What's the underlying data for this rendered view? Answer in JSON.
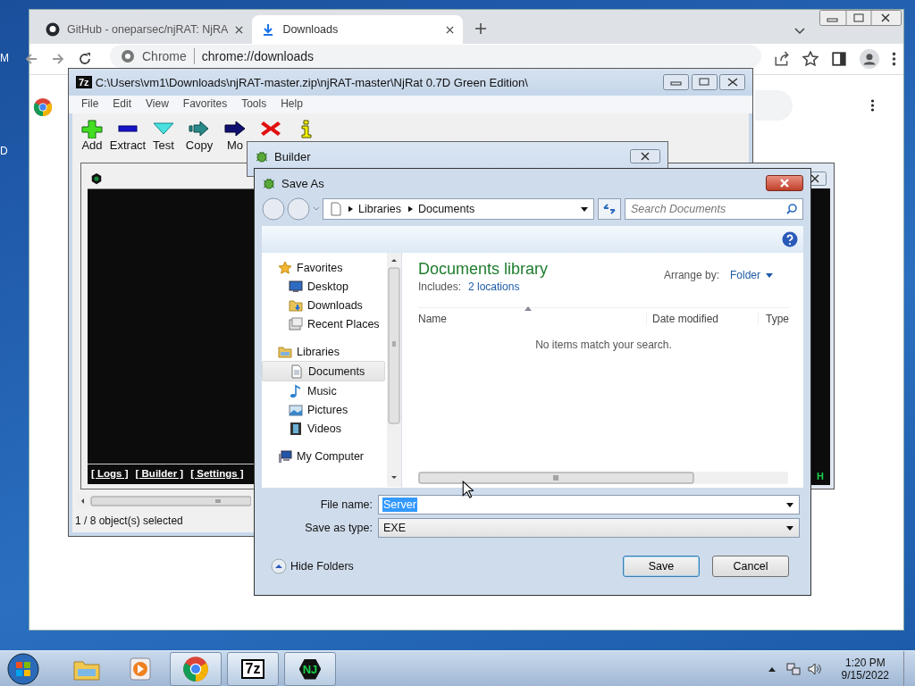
{
  "desktop": {
    "icon_labels": [
      "M",
      "D"
    ]
  },
  "browser": {
    "tabs": [
      {
        "title": "GitHub - oneparsec/njRAT: NjRA",
        "kind": "github",
        "selected": false
      },
      {
        "title": "Downloads",
        "kind": "download",
        "selected": true
      }
    ],
    "site_chip": "Chrome",
    "url": "chrome://downloads"
  },
  "archive_window": {
    "icon_text": "7z",
    "title": "C:\\Users\\vm1\\Downloads\\njRAT-master.zip\\njRAT-master\\NjRat 0.7D Green Edition\\",
    "menu": [
      "File",
      "Edit",
      "View",
      "Favorites",
      "Tools",
      "Help"
    ],
    "toolbar": [
      {
        "kind": "add",
        "label": "Add"
      },
      {
        "kind": "extract",
        "label": "Extract"
      },
      {
        "kind": "test",
        "label": "Test"
      },
      {
        "kind": "copy",
        "label": "Copy"
      },
      {
        "kind": "move",
        "label": "Mo"
      },
      {
        "kind": "delete"
      },
      {
        "kind": "info"
      }
    ],
    "status": "1 / 8 object(s) selected"
  },
  "njrat_window": {
    "links": [
      "[ Logs ]",
      "[ Builder ]",
      "[ Settings ]"
    ]
  },
  "njrat_window_2": {
    "status_letter": "H"
  },
  "builder_window": {
    "title": "Builder"
  },
  "save_dialog": {
    "title": "Save As",
    "breadcrumb": [
      "Libraries",
      "Documents"
    ],
    "search": {
      "placeholder": "Search Documents"
    },
    "nav": [
      {
        "label": "Favorites",
        "kind": "star",
        "selected": false,
        "children": [
          {
            "label": "Desktop",
            "kind": "desktop",
            "selected": false
          },
          {
            "label": "Downloads",
            "kind": "downloads",
            "selected": false
          },
          {
            "label": "Recent Places",
            "kind": "recent",
            "selected": false
          }
        ]
      },
      {
        "label": "Libraries",
        "kind": "library",
        "selected": false,
        "children": [
          {
            "label": "Documents",
            "kind": "documents",
            "selected": true
          },
          {
            "label": "Music",
            "kind": "music",
            "selected": false
          },
          {
            "label": "Pictures",
            "kind": "pictures",
            "selected": false
          },
          {
            "label": "Videos",
            "kind": "videos",
            "selected": false
          }
        ]
      },
      {
        "label": "My Computer",
        "kind": "computer",
        "selected": false
      }
    ],
    "library_title": "Documents library",
    "includes_label": "Includes:",
    "includes_link": "2 locations",
    "arrange_label": "Arrange by:",
    "arrange_value": "Folder",
    "columns": [
      "Name",
      "Date modified",
      "Type"
    ],
    "empty_message": "No items match your search.",
    "file_name": {
      "label": "File name:",
      "value": "Server",
      "text_selected": true
    },
    "save_type": {
      "label": "Save as type:",
      "value": "EXE"
    },
    "hide_folders": "Hide Folders",
    "buttons": [
      {
        "label": "Save",
        "default": true
      },
      {
        "label": "Cancel",
        "default": false
      }
    ]
  },
  "taskbar": {
    "items": [
      {
        "kind": "explorer",
        "running": false
      },
      {
        "kind": "media",
        "running": false
      },
      {
        "kind": "chrome",
        "running": true
      },
      {
        "kind": "sevenzip",
        "label": "7z",
        "running": true
      },
      {
        "kind": "njrat",
        "label": "NJ",
        "running": true
      }
    ],
    "time": "1:20 PM",
    "date": "9/15/2022"
  }
}
